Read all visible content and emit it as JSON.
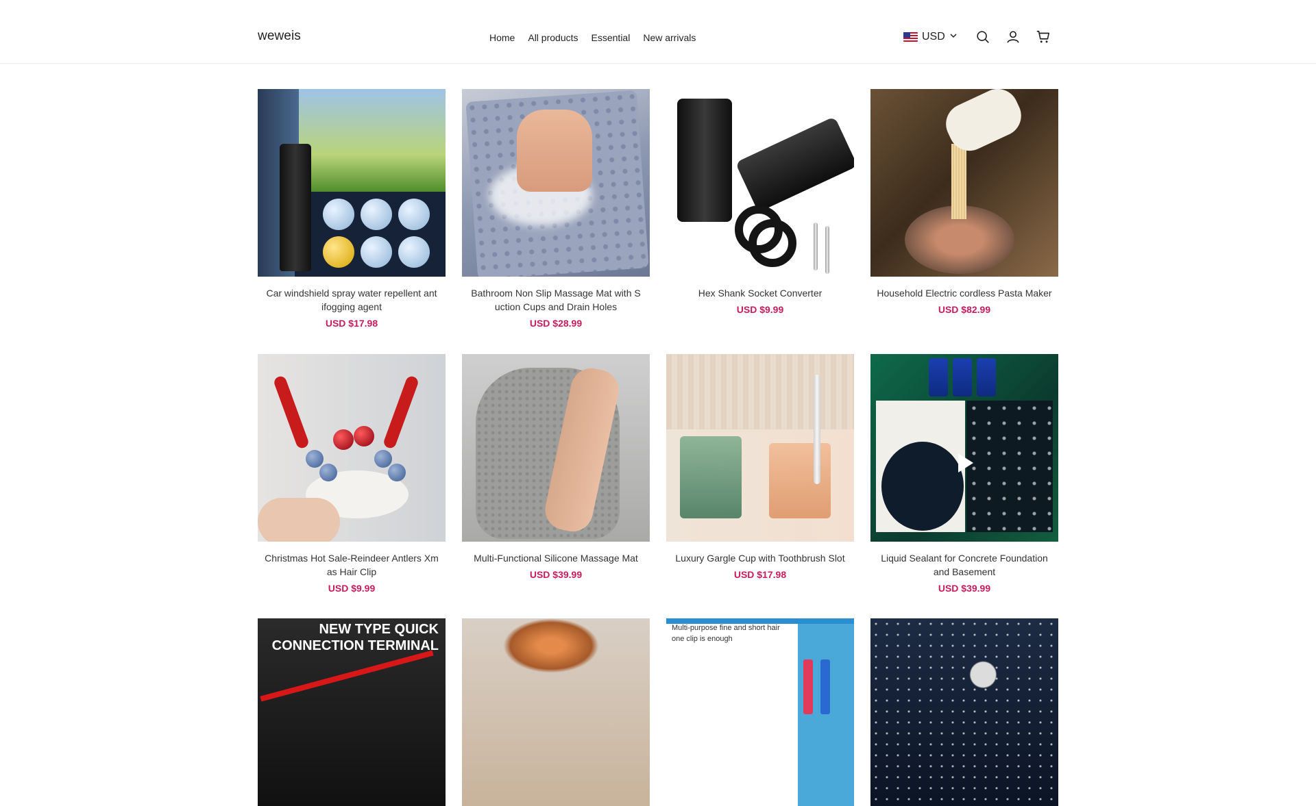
{
  "header": {
    "logo": "weweis",
    "nav": [
      "Home",
      "All products",
      "Essential",
      "New arrivals"
    ],
    "currency": "USD",
    "icons": [
      "search-icon",
      "account-icon",
      "cart-icon"
    ]
  },
  "products": [
    {
      "title": "Car windshield spray water repellent antifogging agent",
      "title_lines": [
        "Car windshield spray water repellent ant",
        "ifogging agent"
      ],
      "price": "USD $17.98"
    },
    {
      "title": "Bathroom Non Slip Massage Mat with Suction Cups and Drain Holes",
      "title_lines": [
        "Bathroom Non Slip Massage Mat with S",
        "uction Cups and Drain Holes"
      ],
      "price": "USD $28.99"
    },
    {
      "title": "Hex Shank Socket Converter",
      "title_lines": [
        "Hex Shank Socket Converter"
      ],
      "price": "USD $9.99"
    },
    {
      "title": "Household Electric cordless Pasta Maker",
      "title_lines": [
        "Household Electric cordless Pasta Maker"
      ],
      "price": "USD $82.99"
    },
    {
      "title": "Christmas Hot Sale-Reindeer Antlers Xmas Hair Clip",
      "title_lines": [
        "Christmas Hot Sale-Reindeer Antlers Xm",
        "as Hair Clip"
      ],
      "price": "USD $9.99"
    },
    {
      "title": "Multi-Functional Silicone Massage Mat",
      "title_lines": [
        "Multi-Functional Silicone Massage Mat"
      ],
      "price": "USD $39.99"
    },
    {
      "title": "Luxury Gargle Cup with Toothbrush Slot",
      "title_lines": [
        "Luxury Gargle Cup with Toothbrush Slot"
      ],
      "price": "USD $17.98"
    },
    {
      "title": "Liquid Sealant for Concrete Foundation and Basement",
      "title_lines": [
        "Liquid Sealant for Concrete Foundation",
        "and Basement"
      ],
      "price": "USD $39.99"
    }
  ],
  "partial_row": {
    "card9_text": [
      "NEW TYPE QUICK",
      "CONNECTION TERMINAL"
    ],
    "card11_text": [
      "Multi-purpose fine and short hair",
      "one clip is enough"
    ]
  },
  "colors": {
    "price": "#c71c5c",
    "border": "#ececec",
    "text": "#222222"
  }
}
